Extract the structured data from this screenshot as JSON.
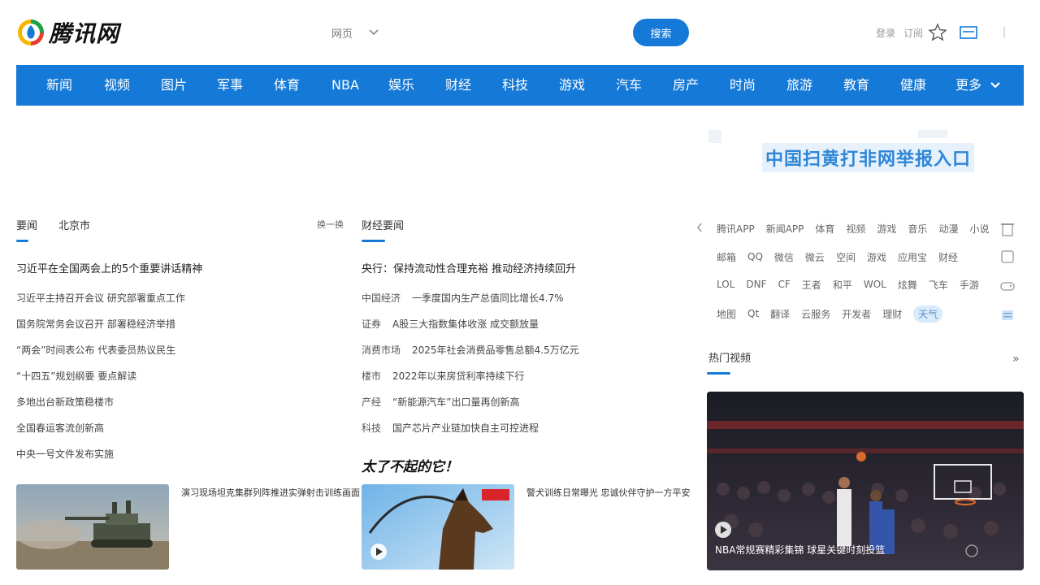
{
  "header": {
    "logo_text": "腾讯网",
    "search_scope": "网页",
    "search_button": "搜索",
    "links": [
      "登录",
      "订阅"
    ]
  },
  "nav": {
    "items": [
      "新闻",
      "视频",
      "图片",
      "军事",
      "体育",
      "NBA",
      "娱乐",
      "财经",
      "科技",
      "游戏",
      "汽车",
      "房产",
      "时尚",
      "旅游",
      "教育",
      "健康",
      "更多"
    ]
  },
  "banner": {
    "text": "中国扫黄打非网举报入口"
  },
  "left_column": {
    "tabs": [
      "要闻",
      "北京市"
    ],
    "more": "换一换",
    "headline": "习近平在全国两会上的5个重要讲话精神",
    "news": [
      "习近平主持召开会议 研究部署重点工作",
      "国务院常务会议召开 部署稳经济举措",
      "“两会”时间表公布 代表委员热议民生",
      "“十四五”规划纲要 要点解读",
      "多地出台新政策稳楼市",
      "全国春运客流创新高",
      "中央一号文件发布实施"
    ],
    "thumb_caption": "演习现场坦克集群列阵推进实弹射击训练画面"
  },
  "middle_column": {
    "tab": "财经要闻",
    "headline": "央行：保持流动性合理充裕 推动经济持续回升",
    "news": [
      {
        "src": "中国经济",
        "text": "一季度国内生产总值同比增长4.7%"
      },
      {
        "src": "证券",
        "text": "A股三大指数集体收涨 成交额放量"
      },
      {
        "src": "消费市场",
        "text": "2025年社会消费品零售总额4.5万亿元"
      },
      {
        "src": "楼市",
        "text": "2022年以来房贷利率持续下行"
      },
      {
        "src": "产经",
        "text": "“新能源汽车”出口量再创新高"
      },
      {
        "src": "科技",
        "text": "国产芯片产业链加快自主可控进程"
      }
    ],
    "promo_title": "太了不起的它！",
    "thumb_caption": "警犬训练日常曝光 忠诚伙伴守护一方平安"
  },
  "right_column": {
    "apps_rows": [
      [
        "腾讯APP",
        "新闻APP",
        "体育",
        "视频",
        "游戏",
        "音乐",
        "动漫",
        "小说"
      ],
      [
        "邮箱",
        "QQ",
        "微信",
        "微云",
        "空间",
        "游戏",
        "应用宝",
        "财经"
      ],
      [
        "LOL",
        "DNF",
        "CF",
        "王者",
        "和平",
        "WOL",
        "炫舞",
        "飞车",
        "手游"
      ],
      [
        "地图",
        "Qt",
        "翻译",
        "云服务",
        "开发者",
        "理财",
        "天气"
      ]
    ],
    "hot_title": "热门视频",
    "hot_more": "»",
    "video_caption": "NBA常规赛精彩集锦 球星关键时刻投篮"
  },
  "colors": {
    "accent": "#1479d7",
    "banner_text": "#2f86d6"
  }
}
